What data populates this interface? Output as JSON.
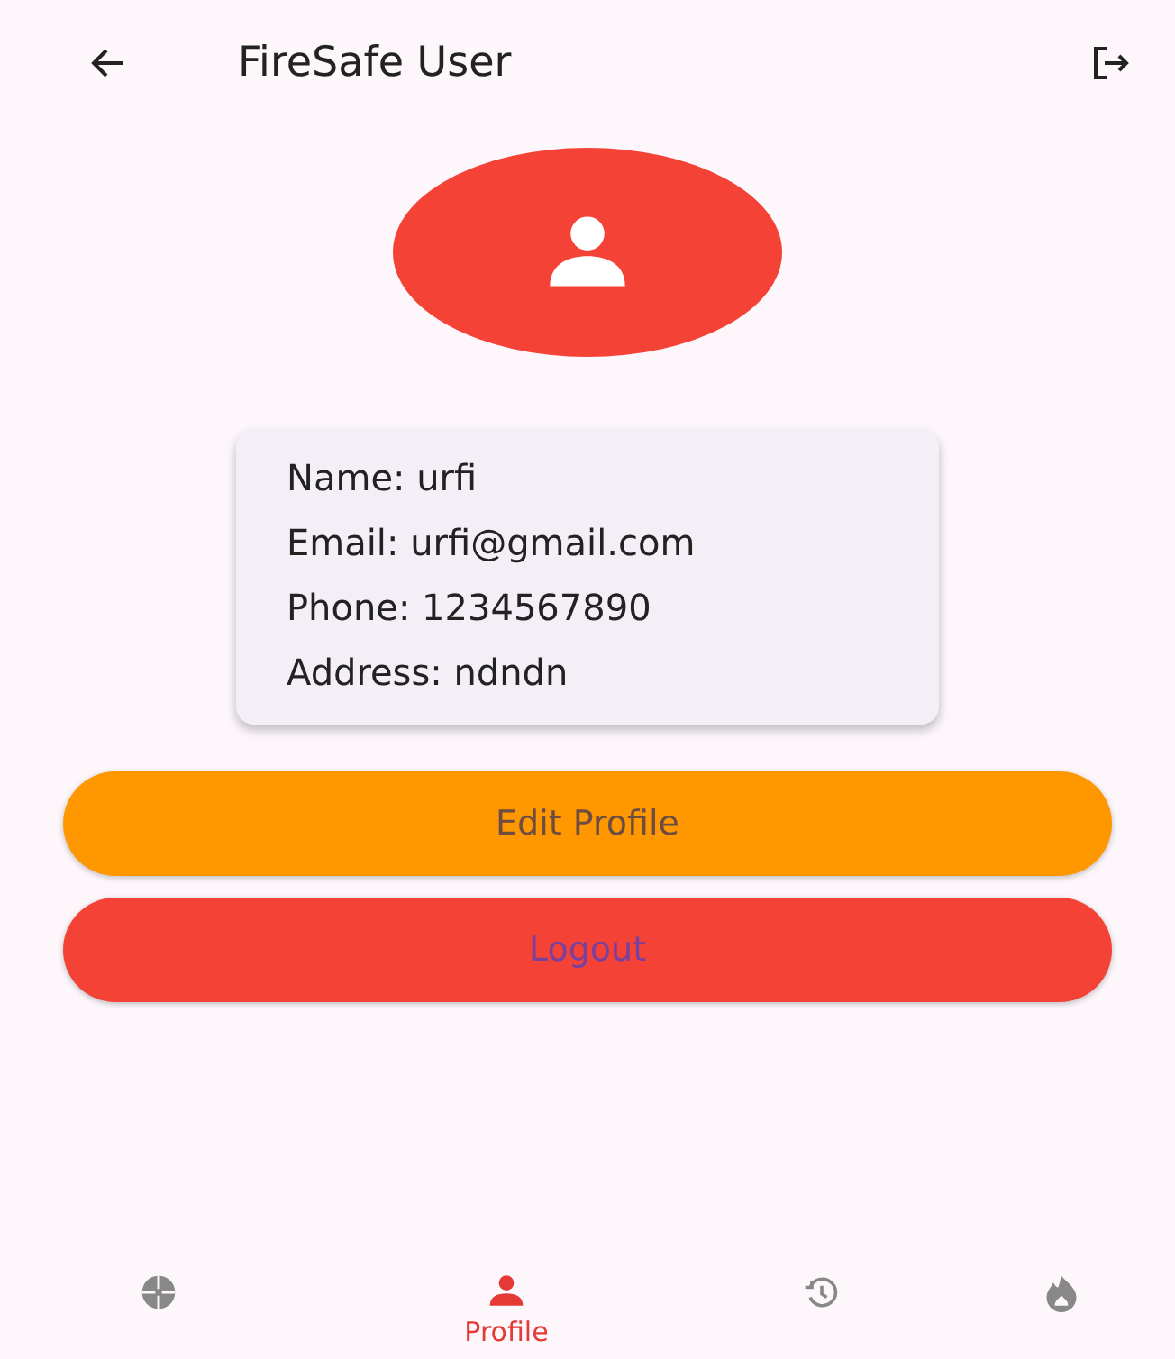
{
  "app_bar": {
    "title": "FireSafe User"
  },
  "profile": {
    "fields": [
      "Name: urfi",
      "Email: urfi@gmail.com",
      "Phone: 1234567890",
      "Address: ndndn"
    ]
  },
  "buttons": [
    {
      "label": "Edit Profile",
      "kind": "edit"
    },
    {
      "label": "Logout",
      "kind": "logout"
    }
  ],
  "bottom_nav": [
    {
      "kind": "camera",
      "selected": false
    },
    {
      "kind": "profile",
      "label": "Profile",
      "selected": true
    },
    {
      "kind": "history",
      "selected": false
    },
    {
      "kind": "fire",
      "selected": false
    }
  ]
}
